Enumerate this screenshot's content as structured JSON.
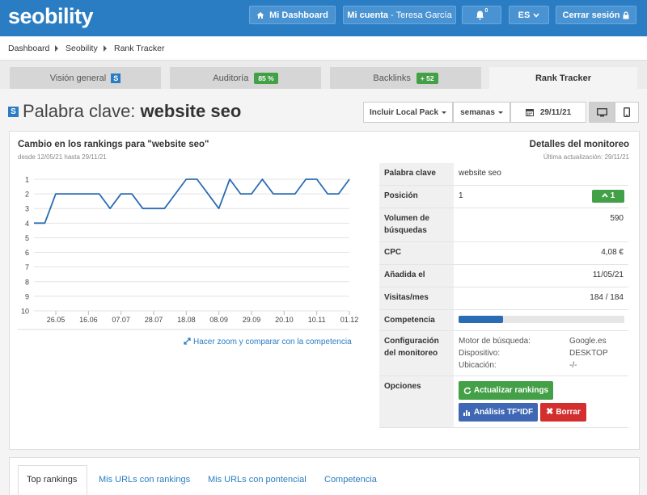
{
  "header": {
    "logo": "seobility",
    "dashboard_label": "Mi Dashboard",
    "account_label": "Mi cuenta",
    "account_user": " - Teresa García",
    "notifications_count": "0",
    "language": "ES",
    "logout_label": "Cerrar sesión"
  },
  "breadcrumb": [
    "Dashboard",
    "Seobility",
    "Rank Tracker"
  ],
  "tabs": [
    {
      "label": "Visión general",
      "badge": ""
    },
    {
      "label": "Auditoría",
      "badge": "85 %"
    },
    {
      "label": "Backlinks",
      "badge": "+ 52"
    },
    {
      "label": "Rank Tracker",
      "badge": ""
    }
  ],
  "title": {
    "prefix": "Palabra clave:",
    "keyword": "website seo"
  },
  "controls": {
    "local_pack": "Incluir Local Pack",
    "period": "semanas",
    "date": "29/11/21"
  },
  "chart_section": {
    "title": "Cambio en los rankings para \"website seo\"",
    "subtitle": "desde 12/05/21 hasta 29/11/21",
    "zoom_link": "Hacer zoom y comparar con la competencia"
  },
  "chart_data": {
    "type": "line",
    "y_ticks": [
      "1",
      "2",
      "3",
      "4",
      "5",
      "6",
      "7",
      "8",
      "9",
      "10"
    ],
    "x_ticks": [
      "26.05",
      "16.06",
      "07.07",
      "28.07",
      "18.08",
      "08.09",
      "29.09",
      "20.10",
      "10.11",
      "01.12"
    ],
    "ylim": [
      1,
      10
    ],
    "inverted_y": true,
    "values": [
      4,
      4,
      2,
      2,
      2,
      2,
      2,
      3,
      2,
      2,
      3,
      3,
      3,
      2,
      1,
      1,
      2,
      3,
      1,
      2,
      2,
      1,
      2,
      2,
      2,
      1,
      1,
      2,
      2,
      1
    ],
    "color": "#2a6cb3",
    "grid": true
  },
  "details": {
    "title": "Detalles del monitoreo",
    "subtitle": "Última actualización: 29/11/21",
    "keyword_label": "Palabra clave",
    "keyword_value": "website seo",
    "position_label": "Posición",
    "position_value": "1",
    "position_change": "1",
    "volume_label": "Volumen de búsquedas",
    "volume_value": "590",
    "cpc_label": "CPC",
    "cpc_value": "4,08 €",
    "added_label": "Añadida el",
    "added_value": "11/05/21",
    "visits_label": "Visitas/mes",
    "visits_value": "184 / 184",
    "competition_label": "Competencia",
    "competition_level": 0.27,
    "config_label": "Configuración del monitoreo",
    "config_keys": [
      "Motor de búsqueda:",
      "Dispositivo:",
      "Ubicación:"
    ],
    "config_values": [
      "Google.es",
      "DESKTOP",
      "-/-"
    ],
    "options_label": "Opciones",
    "btn_update": "Actualizar rankings",
    "btn_tfidf": "Análisis TF*IDF",
    "btn_delete": "Borrar"
  },
  "bottom_tabs": [
    "Top rankings",
    "Mis URLs con rankings",
    "Mis URLs con pontencial",
    "Competencia"
  ],
  "colors": {
    "brand": "#2a7dc3",
    "green": "#43a047",
    "red": "#d32f2f",
    "purple_btn": "#3f67b3"
  }
}
